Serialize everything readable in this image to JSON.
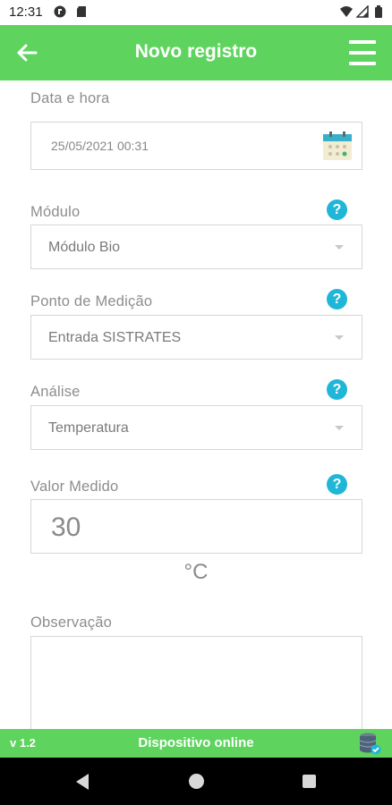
{
  "status_bar": {
    "time": "12:31"
  },
  "app_bar": {
    "title": "Novo registro"
  },
  "form": {
    "date": {
      "label": "Data e hora",
      "value": "25/05/2021 00:31"
    },
    "module": {
      "label": "Módulo",
      "value": "Módulo Bio",
      "help": "?"
    },
    "point": {
      "label": "Ponto de Medição",
      "value": "Entrada SISTRATES",
      "help": "?"
    },
    "analysis": {
      "label": "Análise",
      "value": "Temperatura",
      "help": "?"
    },
    "measured": {
      "label": "Valor Medido",
      "value": "30",
      "unit": "°C",
      "help": "?"
    },
    "observation": {
      "label": "Observação",
      "value": ""
    }
  },
  "footer": {
    "version": "v 1.2",
    "status": "Dispositivo online"
  },
  "colors": {
    "brand_green": "#5ed45e",
    "help_blue": "#1fb6d8"
  }
}
